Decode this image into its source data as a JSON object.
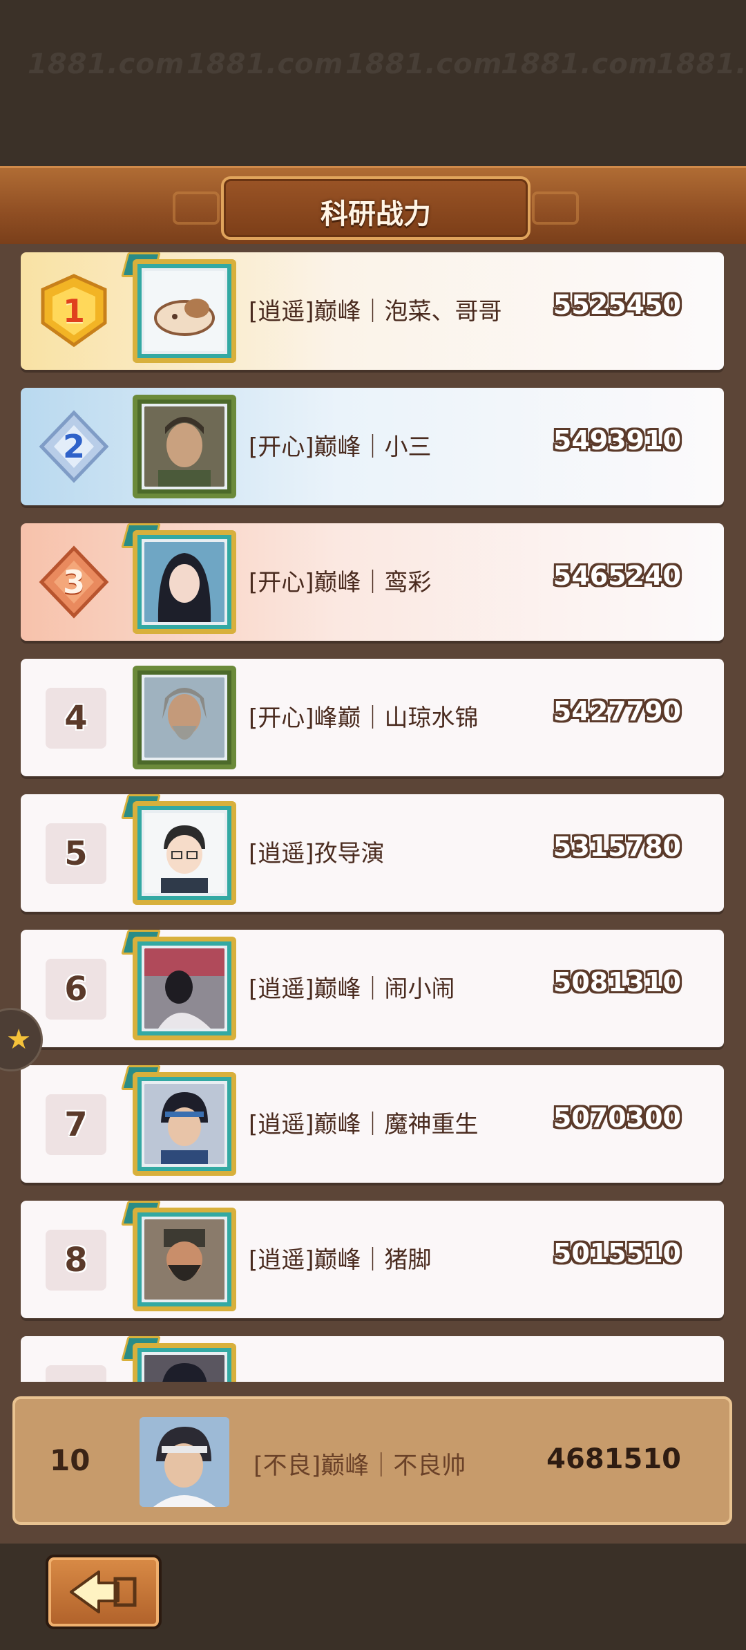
{
  "watermark": "1881.com",
  "header": {
    "title": "科研战力"
  },
  "rows": [
    {
      "rank": "1",
      "name": "[逍遥]巅峰｜泡菜、哥哥",
      "power": "5525450",
      "medal": "gold"
    },
    {
      "rank": "2",
      "name": "[开心]巅峰｜小三",
      "power": "5493910",
      "medal": "silver"
    },
    {
      "rank": "3",
      "name": "[开心]巅峰｜鸾彩",
      "power": "5465240",
      "medal": "bronze"
    },
    {
      "rank": "4",
      "name": "[开心]峰巅｜山琼水锦",
      "power": "5427790"
    },
    {
      "rank": "5",
      "name": "[逍遥]孜导演",
      "power": "5315780"
    },
    {
      "rank": "6",
      "name": "[逍遥]巅峰｜闹小闹",
      "power": "5081310"
    },
    {
      "rank": "7",
      "name": "[逍遥]巅峰｜魔神重生",
      "power": "5070300"
    },
    {
      "rank": "8",
      "name": "[逍遥]巅峰｜猪脚",
      "power": "5015510"
    }
  ],
  "my_rank": {
    "rank": "10",
    "name": "[不良]巅峰｜不良帅",
    "power": "4681510"
  },
  "icons": {
    "side": "star-icon",
    "back": "back-arrow-icon"
  },
  "colors": {
    "panel": "#5c4537",
    "header": "#9a5426",
    "my_row": "#c79b6b"
  }
}
